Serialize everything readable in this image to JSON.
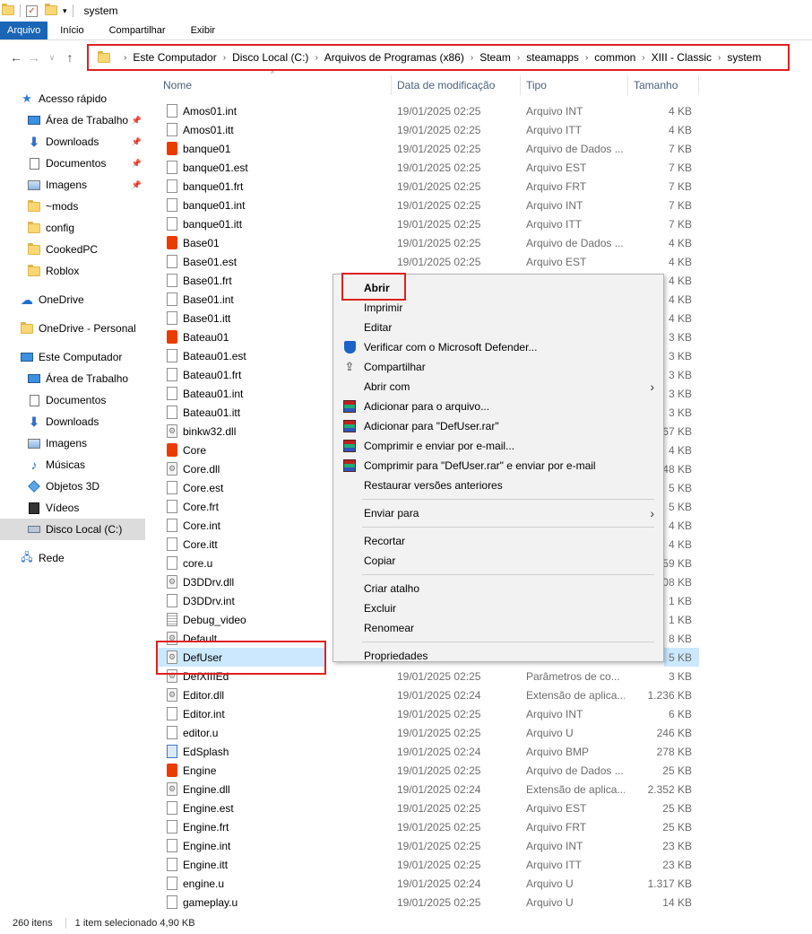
{
  "window": {
    "title": "system"
  },
  "ribbon": {
    "tabs": [
      "Arquivo",
      "Início",
      "Compartilhar",
      "Exibir"
    ]
  },
  "address": {
    "crumbs": [
      "Este Computador",
      "Disco Local (C:)",
      "Arquivos de Programas (x86)",
      "Steam",
      "steamapps",
      "common",
      "XIII - Classic",
      "system"
    ]
  },
  "nav": {
    "items": [
      {
        "label": "Acesso rápido",
        "icon": "star-icon",
        "pin": false
      },
      {
        "label": "Área de Trabalho",
        "icon": "desktop-icon",
        "pin": true
      },
      {
        "label": "Downloads",
        "icon": "download-icon",
        "pin": true
      },
      {
        "label": "Documentos",
        "icon": "documents-icon",
        "pin": true
      },
      {
        "label": "Imagens",
        "icon": "pictures-icon",
        "pin": true
      },
      {
        "label": "~mods",
        "icon": "folder-icon",
        "pin": false
      },
      {
        "label": "config",
        "icon": "folder-icon",
        "pin": false
      },
      {
        "label": "CookedPC",
        "icon": "folder-icon",
        "pin": false
      },
      {
        "label": "Roblox",
        "icon": "folder-icon",
        "pin": false
      },
      {
        "label": "OneDrive",
        "icon": "cloud-icon",
        "pin": false
      },
      {
        "label": "OneDrive - Personal",
        "icon": "folder-icon",
        "pin": false
      },
      {
        "label": "Este Computador",
        "icon": "computer-icon",
        "pin": false
      },
      {
        "label": "Área de Trabalho",
        "icon": "desktop-icon",
        "pin": false
      },
      {
        "label": "Documentos",
        "icon": "documents-icon",
        "pin": false
      },
      {
        "label": "Downloads",
        "icon": "download-icon",
        "pin": false
      },
      {
        "label": "Imagens",
        "icon": "pictures-icon",
        "pin": false
      },
      {
        "label": "Músicas",
        "icon": "music-icon",
        "pin": false
      },
      {
        "label": "Objetos 3D",
        "icon": "cube-icon",
        "pin": false
      },
      {
        "label": "Vídeos",
        "icon": "video-icon",
        "pin": false
      },
      {
        "label": "Disco Local (C:)",
        "icon": "drive-icon",
        "pin": false
      },
      {
        "label": "Rede",
        "icon": "network-icon",
        "pin": false
      }
    ]
  },
  "columns": {
    "name": "Nome",
    "date": "Data de modificação",
    "type": "Tipo",
    "size": "Tamanho"
  },
  "files": [
    {
      "name": "Amos01.int",
      "date": "19/01/2025 02:25",
      "type": "Arquivo INT",
      "size": "4 KB",
      "icon": "doc"
    },
    {
      "name": "Amos01.itt",
      "date": "19/01/2025 02:25",
      "type": "Arquivo ITT",
      "size": "4 KB",
      "icon": "doc"
    },
    {
      "name": "banque01",
      "date": "19/01/2025 02:25",
      "type": "Arquivo de Dados ...",
      "size": "7 KB",
      "icon": "office"
    },
    {
      "name": "banque01.est",
      "date": "19/01/2025 02:25",
      "type": "Arquivo EST",
      "size": "7 KB",
      "icon": "doc"
    },
    {
      "name": "banque01.frt",
      "date": "19/01/2025 02:25",
      "type": "Arquivo FRT",
      "size": "7 KB",
      "icon": "doc"
    },
    {
      "name": "banque01.int",
      "date": "19/01/2025 02:25",
      "type": "Arquivo INT",
      "size": "7 KB",
      "icon": "doc"
    },
    {
      "name": "banque01.itt",
      "date": "19/01/2025 02:25",
      "type": "Arquivo ITT",
      "size": "7 KB",
      "icon": "doc"
    },
    {
      "name": "Base01",
      "date": "19/01/2025 02:25",
      "type": "Arquivo de Dados ...",
      "size": "4 KB",
      "icon": "office"
    },
    {
      "name": "Base01.est",
      "date": "19/01/2025 02:25",
      "type": "Arquivo EST",
      "size": "4 KB",
      "icon": "doc"
    },
    {
      "name": "Base01.frt",
      "date": "",
      "type": "",
      "size": "4 KB",
      "icon": "doc"
    },
    {
      "name": "Base01.int",
      "date": "",
      "type": "",
      "size": "4 KB",
      "icon": "doc"
    },
    {
      "name": "Base01.itt",
      "date": "",
      "type": "",
      "size": "4 KB",
      "icon": "doc"
    },
    {
      "name": "Bateau01",
      "date": "",
      "type": "",
      "size": "3 KB",
      "icon": "office"
    },
    {
      "name": "Bateau01.est",
      "date": "",
      "type": "",
      "size": "3 KB",
      "icon": "doc"
    },
    {
      "name": "Bateau01.frt",
      "date": "",
      "type": "",
      "size": "3 KB",
      "icon": "doc"
    },
    {
      "name": "Bateau01.int",
      "date": "",
      "type": "",
      "size": "3 KB",
      "icon": "doc"
    },
    {
      "name": "Bateau01.itt",
      "date": "",
      "type": "",
      "size": "3 KB",
      "icon": "doc"
    },
    {
      "name": "binkw32.dll",
      "date": "",
      "type": "",
      "size": "367 KB",
      "icon": "gear"
    },
    {
      "name": "Core",
      "date": "",
      "type": "",
      "size": "4 KB",
      "icon": "office"
    },
    {
      "name": "Core.dll",
      "date": "",
      "type": "",
      "size": "648 KB",
      "icon": "gear"
    },
    {
      "name": "Core.est",
      "date": "",
      "type": "",
      "size": "5 KB",
      "icon": "doc"
    },
    {
      "name": "Core.frt",
      "date": "",
      "type": "",
      "size": "5 KB",
      "icon": "doc"
    },
    {
      "name": "Core.int",
      "date": "",
      "type": "",
      "size": "4 KB",
      "icon": "doc"
    },
    {
      "name": "Core.itt",
      "date": "",
      "type": "",
      "size": "4 KB",
      "icon": "doc"
    },
    {
      "name": "core.u",
      "date": "",
      "type": "",
      "size": "159 KB",
      "icon": "doc"
    },
    {
      "name": "D3DDrv.dll",
      "date": "",
      "type": "",
      "size": "408 KB",
      "icon": "gear"
    },
    {
      "name": "D3DDrv.int",
      "date": "",
      "type": "",
      "size": "1 KB",
      "icon": "doc"
    },
    {
      "name": "Debug_video",
      "date": "",
      "type": "",
      "size": "1 KB",
      "icon": "lines"
    },
    {
      "name": "Default",
      "date": "",
      "type": "",
      "size": "8 KB",
      "icon": "gear"
    },
    {
      "name": "DefUser",
      "date": "",
      "type": "",
      "size": "5 KB",
      "icon": "gear",
      "selected": true
    },
    {
      "name": "DefXIIIEd",
      "date": "19/01/2025 02:25",
      "type": "Parâmetros de co...",
      "size": "3 KB",
      "icon": "gear"
    },
    {
      "name": "Editor.dll",
      "date": "19/01/2025 02:24",
      "type": "Extensão de aplica...",
      "size": "1.236 KB",
      "icon": "gear"
    },
    {
      "name": "Editor.int",
      "date": "19/01/2025 02:25",
      "type": "Arquivo INT",
      "size": "6 KB",
      "icon": "doc"
    },
    {
      "name": "editor.u",
      "date": "19/01/2025 02:25",
      "type": "Arquivo U",
      "size": "246 KB",
      "icon": "doc"
    },
    {
      "name": "EdSplash",
      "date": "19/01/2025 02:24",
      "type": "Arquivo BMP",
      "size": "278 KB",
      "icon": "bmp"
    },
    {
      "name": "Engine",
      "date": "19/01/2025 02:25",
      "type": "Arquivo de Dados ...",
      "size": "25 KB",
      "icon": "office"
    },
    {
      "name": "Engine.dll",
      "date": "19/01/2025 02:24",
      "type": "Extensão de aplica...",
      "size": "2.352 KB",
      "icon": "gear"
    },
    {
      "name": "Engine.est",
      "date": "19/01/2025 02:25",
      "type": "Arquivo EST",
      "size": "25 KB",
      "icon": "doc"
    },
    {
      "name": "Engine.frt",
      "date": "19/01/2025 02:25",
      "type": "Arquivo FRT",
      "size": "25 KB",
      "icon": "doc"
    },
    {
      "name": "Engine.int",
      "date": "19/01/2025 02:25",
      "type": "Arquivo INT",
      "size": "23 KB",
      "icon": "doc"
    },
    {
      "name": "Engine.itt",
      "date": "19/01/2025 02:25",
      "type": "Arquivo ITT",
      "size": "23 KB",
      "icon": "doc"
    },
    {
      "name": "engine.u",
      "date": "19/01/2025 02:24",
      "type": "Arquivo U",
      "size": "1.317 KB",
      "icon": "doc"
    },
    {
      "name": "gameplay.u",
      "date": "19/01/2025 02:25",
      "type": "Arquivo U",
      "size": "14 KB",
      "icon": "doc"
    }
  ],
  "context_menu": {
    "items": [
      {
        "label": "Abrir",
        "bold": true
      },
      {
        "label": "Imprimir"
      },
      {
        "label": "Editar"
      },
      {
        "label": "Verificar com o Microsoft Defender...",
        "icon": "defender-icon"
      },
      {
        "label": "Compartilhar",
        "icon": "share-icon"
      },
      {
        "label": "Abrir com",
        "submenu": true
      },
      {
        "label": "Adicionar para o arquivo...",
        "icon": "winrar-icon"
      },
      {
        "label": "Adicionar para \"DefUser.rar\"",
        "icon": "winrar-icon"
      },
      {
        "label": "Comprimir e enviar por e-mail...",
        "icon": "winrar-icon"
      },
      {
        "label": "Comprimir para \"DefUser.rar\" e enviar por e-mail",
        "icon": "winrar-icon"
      },
      {
        "label": "Restaurar versões anteriores"
      },
      {
        "sep": true
      },
      {
        "label": "Enviar para",
        "submenu": true
      },
      {
        "sep": true
      },
      {
        "label": "Recortar"
      },
      {
        "label": "Copiar"
      },
      {
        "sep": true
      },
      {
        "label": "Criar atalho"
      },
      {
        "label": "Excluir"
      },
      {
        "label": "Renomear"
      },
      {
        "sep": true
      },
      {
        "label": "Propriedades"
      }
    ]
  },
  "status": {
    "count": "260 itens",
    "selected": "1 item selecionado  4,90 KB"
  },
  "colors": {
    "highlight": "#e02020",
    "selection": "#cce8ff",
    "file_tab": "#1a65b5"
  }
}
